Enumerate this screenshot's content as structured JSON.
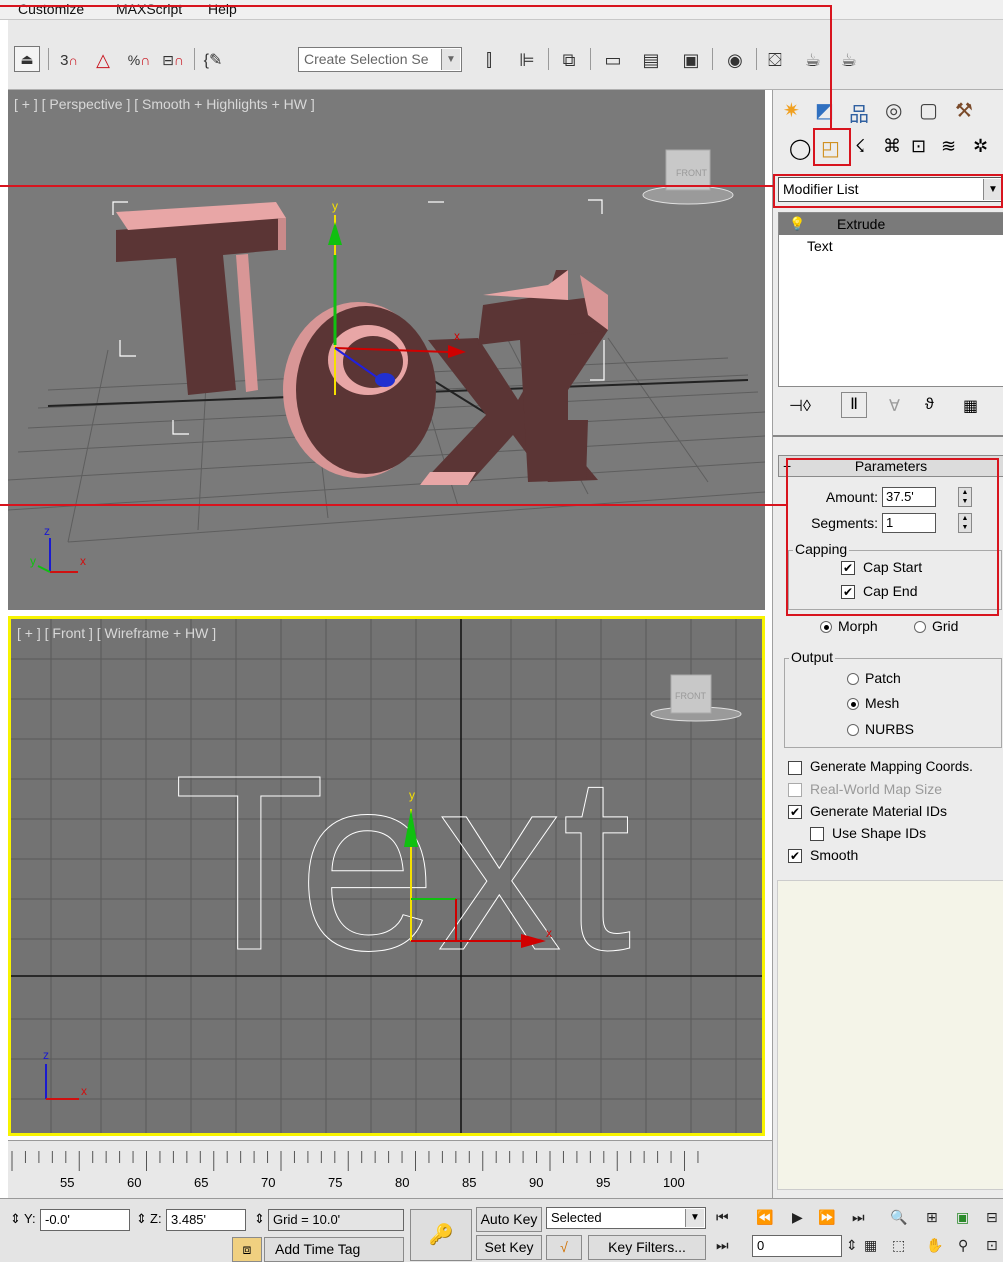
{
  "menu": {
    "items": [
      "Customize",
      "MAXScript",
      "Help"
    ]
  },
  "toolbar": {
    "selection_set_placeholder": "Create Selection Se",
    "snap_3d": "3",
    "icons": [
      "undo-scene-icon",
      "snap-3d-icon",
      "angle-snap-icon",
      "percent-snap-icon",
      "spinner-snap-icon",
      "edit-named-selection-icon",
      "mirror-icon",
      "align-icon",
      "layer-manager-icon",
      "curve-editor-icon",
      "schematic-view-icon",
      "material-editor-icon",
      "render-setup-icon",
      "render-frame-icon",
      "render-icon"
    ]
  },
  "viewports": {
    "perspective": {
      "label": "[ + ] [ Perspective ] [ Smooth + Highlights + HW ]",
      "object_text": "Text",
      "viewcube_face": "FRONT"
    },
    "front": {
      "label": "[ + ] [ Front ] [ Wireframe + HW ]",
      "object_text": "Text",
      "viewcube_face": "FRONT"
    }
  },
  "command_panel": {
    "modifier_list": "Modifier List",
    "stack": [
      "Extrude",
      "Text"
    ],
    "parameters_title": "Parameters",
    "amount_label": "Amount:",
    "amount_value": "37.5'",
    "segments_label": "Segments:",
    "segments_value": "1",
    "capping_title": "Capping",
    "cap_start": "Cap Start",
    "cap_end": "Cap End",
    "morph": "Morph",
    "grid": "Grid",
    "output_title": "Output",
    "patch": "Patch",
    "mesh": "Mesh",
    "nurbs": "NURBS",
    "gen_mapping": "Generate Mapping Coords.",
    "real_world": "Real-World Map Size",
    "gen_material_ids": "Generate Material IDs",
    "use_shape_ids": "Use Shape IDs",
    "smooth": "Smooth"
  },
  "timeline": {
    "ticks": [
      "55",
      "60",
      "65",
      "70",
      "75",
      "80",
      "85",
      "90",
      "95",
      "100"
    ]
  },
  "bottom_bar": {
    "y_label": "Y:",
    "y_value": "-0.0'",
    "z_label": "Z:",
    "z_value": "3.485'",
    "grid_text": "Grid = 10.0'",
    "add_time_tag": "Add Time Tag",
    "auto_key": "Auto Key",
    "set_key": "Set Key",
    "selected": "Selected",
    "key_filters": "Key Filters...",
    "frame_value": "0"
  },
  "colors": {
    "annotation_red": "#d8141e",
    "active_viewport_border": "#f7f300",
    "text_object": "#e8a6a6"
  }
}
